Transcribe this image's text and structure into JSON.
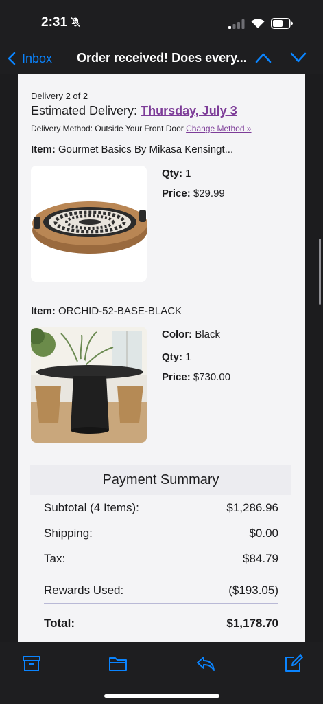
{
  "status_bar": {
    "time": "2:31"
  },
  "nav": {
    "back_label": "Inbox",
    "title": "Order received! Does every..."
  },
  "delivery": {
    "count": "Delivery 2 of 2",
    "estimated_label": "Estimated Delivery:",
    "estimated_date": "Thursday, July 3",
    "method_label": "Delivery Method: Outside Your Front Door",
    "change_label": "Change Method »"
  },
  "items": [
    {
      "item_label": "Item:",
      "name": "Gourmet Basics By Mikasa Kensingt...",
      "qty_label": "Qty:",
      "qty": "1",
      "price_label": "Price:",
      "price": "$29.99"
    },
    {
      "item_label": "Item:",
      "name": "ORCHID-52-BASE-BLACK",
      "color_label": "Color:",
      "color": "Black",
      "qty_label": "Qty:",
      "qty": "1",
      "price_label": "Price:",
      "price": "$730.00"
    }
  ],
  "summary": {
    "title": "Payment Summary",
    "subtotal_label": "Subtotal (4 Items):",
    "subtotal": "$1,286.96",
    "shipping_label": "Shipping:",
    "shipping": "$0.00",
    "tax_label": "Tax:",
    "tax": "$84.79",
    "rewards_label": "Rewards Used:",
    "rewards": "($193.05)",
    "total_label": "Total:",
    "total": "$1,178.70"
  },
  "colors": {
    "accent": "#0a84ff",
    "link_purple": "#7d3c98",
    "email_bg": "#f4f4f6",
    "chrome_bg": "#1e1e20"
  }
}
